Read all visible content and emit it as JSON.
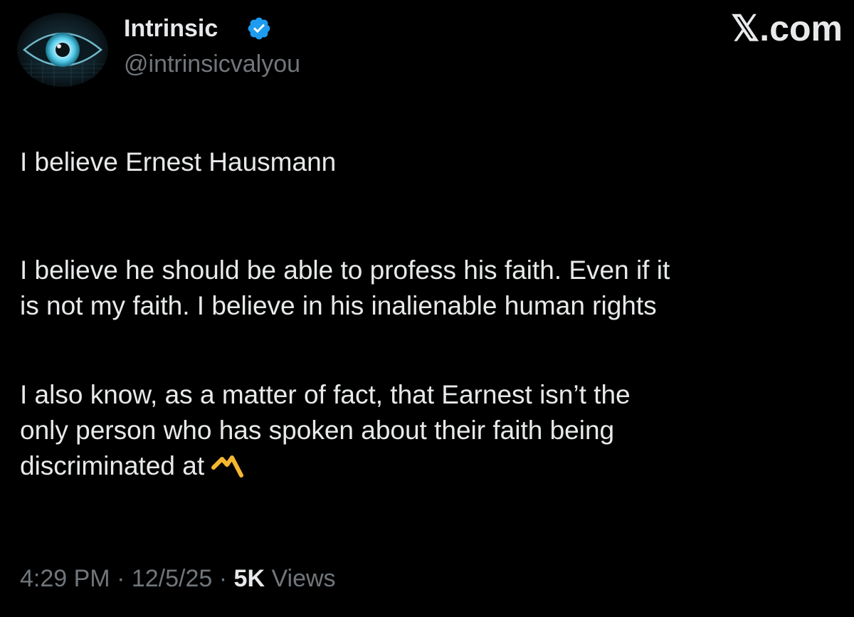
{
  "author": {
    "name": "Intrinsic",
    "handle": "@intrinsicvalyou",
    "verified": true,
    "avatar_icon": "eye-icon"
  },
  "brand": "𝕏.com",
  "post": {
    "paragraphs": [
      [
        "I believe Ernest Hausmann"
      ],
      [
        "I believe he should be able to profess his faith. Even if it",
        "is not my faith. I believe in his inalienable human rights"
      ],
      [
        "I also know, as a matter of fact, that Earnest isn’t the",
        "only person who has spoken about their faith being",
        "discriminated at"
      ]
    ],
    "trailing_emoji": "m-logo-emoji"
  },
  "meta": {
    "time": "4:29 PM",
    "separator": "·",
    "date": "12/5/25",
    "views_count": "5K",
    "views_label": "Views"
  },
  "colors": {
    "background": "#000000",
    "text_primary": "#e7e9ea",
    "text_secondary": "#71767b",
    "verified_badge": "#1d9bf0",
    "emoji": "#f5b731"
  }
}
